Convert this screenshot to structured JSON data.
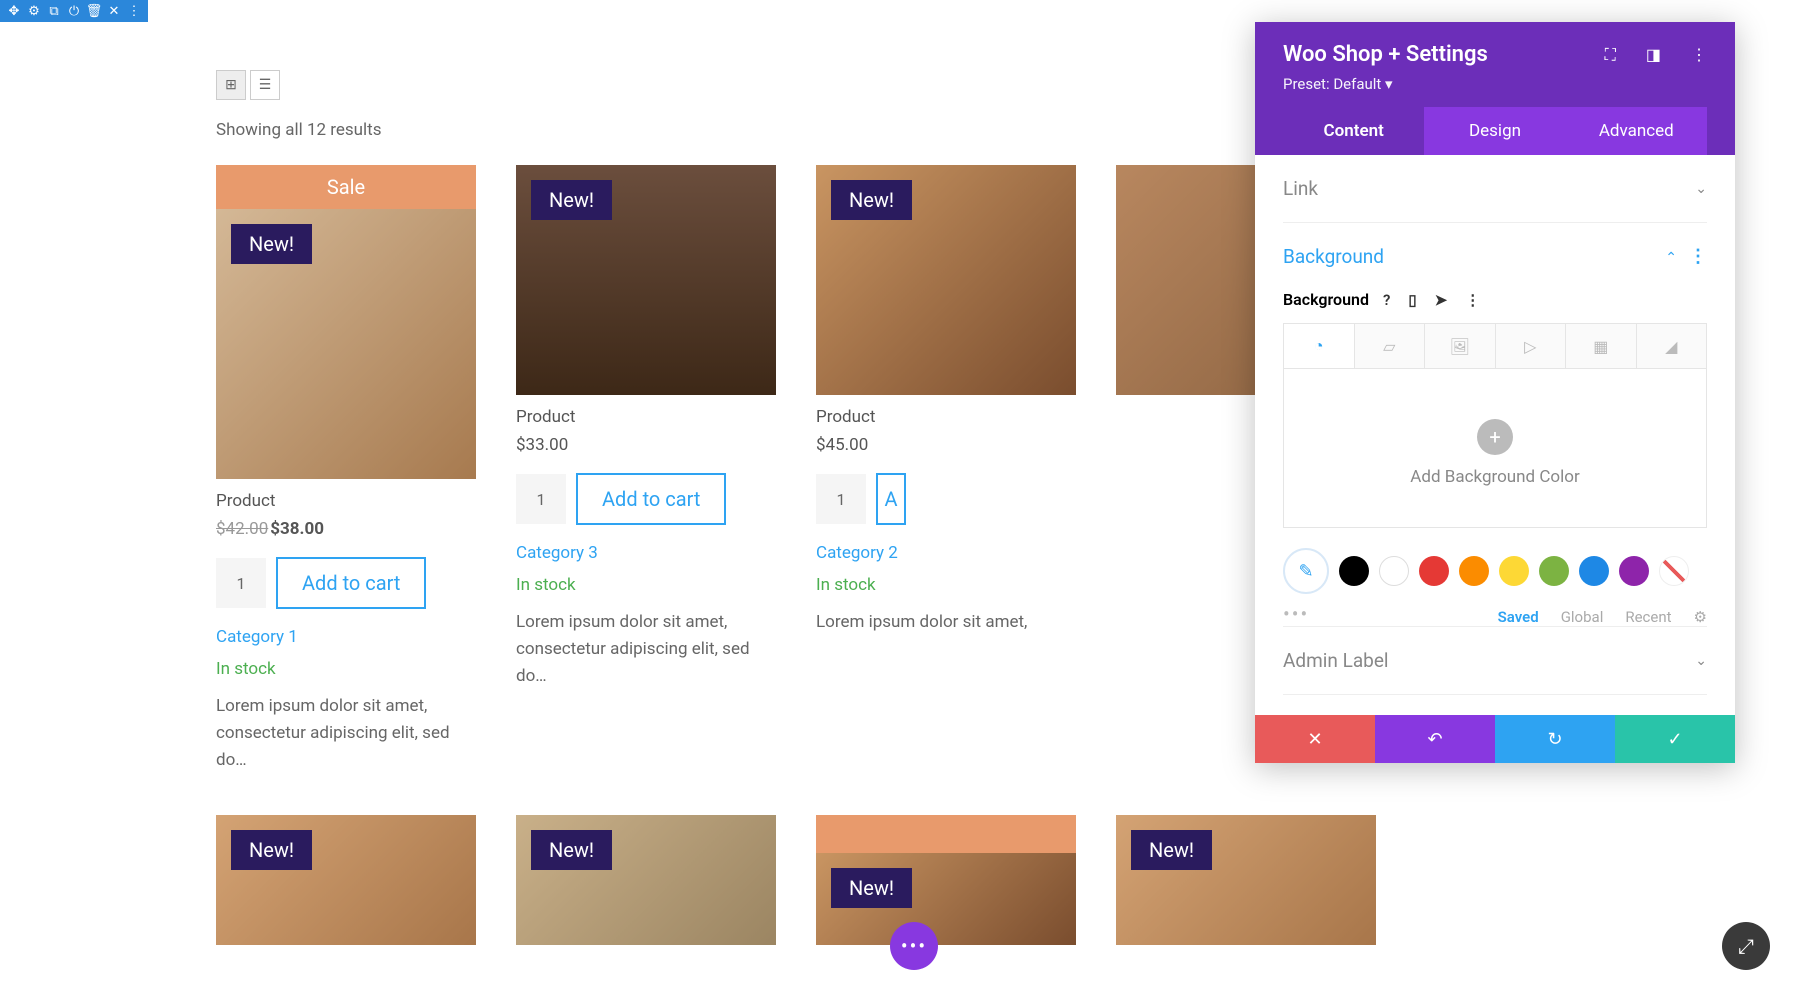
{
  "toolbar": [
    "✥",
    "⚙",
    "⧉",
    "⏻",
    "🗑",
    "✕",
    "⋮"
  ],
  "viewToggle": {
    "grid": "⊞",
    "list": "☰"
  },
  "resultsText": "Showing all 12 results",
  "saleLabel": "Sale",
  "newLabel": "New!",
  "products": [
    {
      "sale": true,
      "title": "Product",
      "oldPrice": "$42.00",
      "price": "$38.00",
      "qty": "1",
      "btn": "Add to cart",
      "category": "Category 1",
      "stock": "In stock",
      "desc": "Lorem ipsum dolor sit amet, consectetur adipiscing elit, sed do…",
      "imgClass": ""
    },
    {
      "sale": false,
      "title": "Product",
      "oldPrice": "",
      "price": "$33.00",
      "qty": "1",
      "btn": "Add to cart",
      "category": "Category 3",
      "stock": "In stock",
      "desc": "Lorem ipsum dolor sit amet, consectetur adipiscing elit, sed do…",
      "imgClass": "bag"
    },
    {
      "sale": false,
      "title": "Product",
      "oldPrice": "",
      "price": "$45.00",
      "qty": "1",
      "btn": "A",
      "category": "Category 2",
      "stock": "In stock",
      "desc": "Lorem ipsum dolor sit amet,",
      "imgClass": "shoe"
    },
    {
      "sale": false,
      "title": "",
      "oldPrice": "",
      "price": "",
      "qty": "",
      "btn": "",
      "category": "",
      "stock": "",
      "desc": "",
      "imgClass": "hair"
    }
  ],
  "row2": [
    {
      "imgClass": "leather",
      "new": true
    },
    {
      "imgClass": "wood",
      "new": true
    },
    {
      "imgClass": "shoe",
      "new": true,
      "sale": true
    },
    {
      "imgClass": "leather",
      "new": true
    }
  ],
  "panel": {
    "title": "Woo Shop + Settings",
    "preset": "Preset: Default ▾",
    "tabs": [
      "Content",
      "Design",
      "Advanced"
    ],
    "linkSection": "Link",
    "bgSection": "Background",
    "bgLabel": "Background",
    "addBgText": "Add Background Color",
    "swatches": [
      "#000000",
      "#ffffff",
      "#e53935",
      "#fb8c00",
      "#fdd835",
      "#7cb342",
      "#1e88e5",
      "#8e24aa"
    ],
    "filters": [
      "Saved",
      "Global",
      "Recent"
    ],
    "adminSection": "Admin Label"
  }
}
